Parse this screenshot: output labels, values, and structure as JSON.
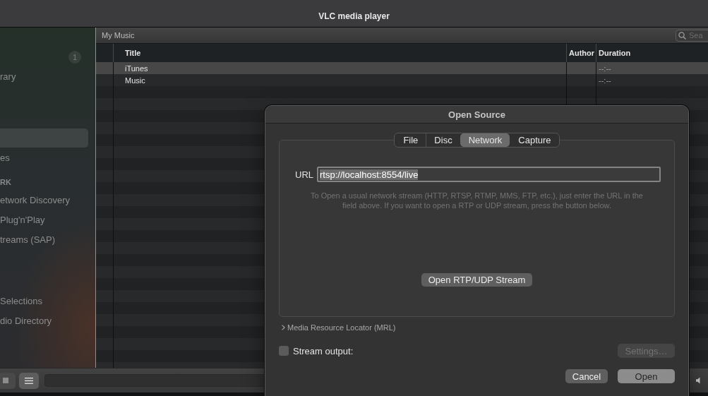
{
  "window": {
    "title": "VLC media player"
  },
  "sidebar": {
    "sections": [
      {
        "badge": "1",
        "items": [
          {
            "label": "rary",
            "selected": false
          }
        ]
      },
      {
        "items": [
          {
            "selected": true
          },
          {
            "label": "es",
            "selected": false
          }
        ]
      },
      {
        "header": "RK",
        "items": [
          {
            "label": "etwork Discovery",
            "selected": false
          },
          {
            "label": "Plug'n'Play",
            "selected": false
          },
          {
            "label": "treams (SAP)",
            "selected": false
          }
        ]
      },
      {
        "items": [
          {
            "label": "Selections",
            "selected": false
          },
          {
            "label": "dio Directory",
            "selected": false
          }
        ]
      }
    ]
  },
  "playlist": {
    "title": "My Music",
    "search": {
      "placeholder": "Sea"
    },
    "columns": [
      "Title",
      "Author",
      "Duration"
    ],
    "rows": [
      {
        "title": "iTunes",
        "duration": "--:--",
        "selected": true
      },
      {
        "title": "Music",
        "duration": "--:--",
        "selected": false
      }
    ]
  },
  "controls": {
    "buttons": [
      {
        "kind": "stop",
        "selected": false
      },
      {
        "kind": "playlist",
        "selected": true
      }
    ]
  },
  "dialog": {
    "title": "Open Source",
    "tabs": [
      {
        "label": "File",
        "selected": false
      },
      {
        "label": "Disc",
        "selected": false
      },
      {
        "label": "Network",
        "selected": true
      },
      {
        "label": "Capture",
        "selected": false
      }
    ],
    "url": {
      "label": "URL",
      "value": "rtsp://localhost:8554/live",
      "value_selected": true
    },
    "help": "To Open a usual network stream (HTTP, RTSP, RTMP, MMS, FTP, etc.), just enter the URL in the field above. If you want to open a RTP or UDP stream, press the button below.",
    "stream_button": "Open RTP/UDP Stream",
    "mrl": {
      "label": "Media Resource Locator (MRL)",
      "expanded": false
    },
    "stream_output": {
      "label": "Stream output:",
      "checked": false
    },
    "settings_button": {
      "label": "Settings…",
      "disabled": true
    },
    "buttons": [
      {
        "label": "Cancel",
        "kind": "normal"
      },
      {
        "label": "Open",
        "kind": "default"
      }
    ]
  }
}
